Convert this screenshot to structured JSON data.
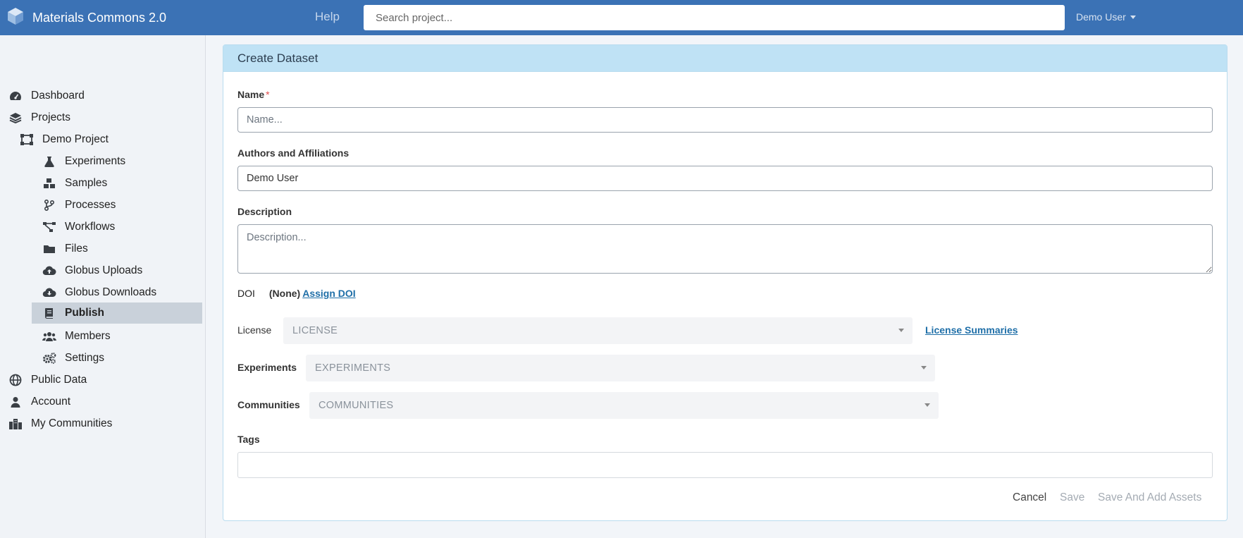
{
  "app": {
    "title": "Materials Commons 2.0",
    "help_label": "Help"
  },
  "search": {
    "placeholder": "Search project..."
  },
  "user_menu": {
    "label": "Demo User"
  },
  "sidebar": {
    "items": [
      {
        "label": "Dashboard",
        "icon": "tachometer-icon"
      },
      {
        "label": "Projects",
        "icon": "layers-icon"
      },
      {
        "label": "Demo Project",
        "icon": "project-diagram-icon"
      },
      {
        "label": "Experiments",
        "icon": "flask-icon"
      },
      {
        "label": "Samples",
        "icon": "cubes-icon"
      },
      {
        "label": "Processes",
        "icon": "code-branch-icon"
      },
      {
        "label": "Workflows",
        "icon": "workflow-icon"
      },
      {
        "label": "Files",
        "icon": "folder-icon"
      },
      {
        "label": "Globus Uploads",
        "icon": "cloud-upload-icon"
      },
      {
        "label": "Globus Downloads",
        "icon": "cloud-download-icon"
      },
      {
        "label": "Publish",
        "icon": "book-icon",
        "active": true
      },
      {
        "label": "Members",
        "icon": "users-icon"
      },
      {
        "label": "Settings",
        "icon": "cogs-icon"
      },
      {
        "label": "Public Data",
        "icon": "globe-icon"
      },
      {
        "label": "Account",
        "icon": "user-icon"
      },
      {
        "label": "My Communities",
        "icon": "city-icon"
      }
    ]
  },
  "form": {
    "header": "Create Dataset",
    "name": {
      "label": "Name",
      "required_mark": "*",
      "placeholder": "Name..."
    },
    "authors": {
      "label": "Authors and Affiliations",
      "value": "Demo User"
    },
    "description": {
      "label": "Description",
      "placeholder": "Description..."
    },
    "doi": {
      "label": "DOI",
      "value": "(None)",
      "assign_label": "Assign DOI"
    },
    "license": {
      "label": "License",
      "placeholder": "LICENSE",
      "summaries_link": "License Summaries"
    },
    "experiments": {
      "label": "Experiments",
      "placeholder": "EXPERIMENTS"
    },
    "communities": {
      "label": "Communities",
      "placeholder": "COMMUNITIES"
    },
    "tags": {
      "label": "Tags"
    },
    "actions": {
      "cancel": "Cancel",
      "save": "Save",
      "save_and_add": "Save And Add Assets"
    }
  },
  "colors": {
    "topbar": "#3b72b5",
    "card_header": "#bfe2f5",
    "link": "#1f6fa8",
    "required": "#e14c4c",
    "active_nav": "#c9d1da"
  }
}
